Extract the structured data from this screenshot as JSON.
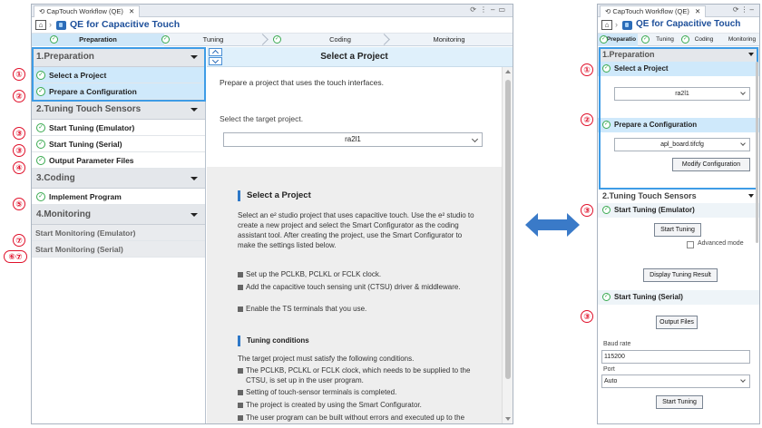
{
  "window_tab": "CapTouch Workflow (QE)",
  "app_title": "QE for Capacitive Touch",
  "steps": [
    "Preparation",
    "Tuning",
    "Coding",
    "Monitoring"
  ],
  "steps_short": [
    "Preparatio",
    "Tuning",
    "Coding",
    "Monitoring"
  ],
  "sidebar": {
    "sections": [
      {
        "title": "1.Preparation",
        "items": [
          "Select a Project",
          "Prepare a Configuration"
        ]
      },
      {
        "title": "2.Tuning Touch Sensors",
        "items": [
          "Start Tuning (Emulator)",
          "Start Tuning (Serial)",
          "Output Parameter Files"
        ]
      },
      {
        "title": "3.Coding",
        "items": [
          "Implement Program"
        ]
      },
      {
        "title": "4.Monitoring",
        "items": [
          "Start Monitoring (Emulator)",
          "Start Monitoring (Serial)"
        ]
      }
    ]
  },
  "markers": [
    "①",
    "②",
    "③",
    "③",
    "④",
    "⑤",
    "⑦",
    "⑥⑦"
  ],
  "main": {
    "header": "Select a Project",
    "description": "Prepare a project that uses the touch interfaces.",
    "target_label": "Select the target project.",
    "project_value": "ra2l1",
    "help_title": "Select a Project",
    "help_para": "Select an e² studio project that uses capacitive touch. Use the e² studio to create a new project and select the Smart Configurator as the coding assistant tool. After creating the project, use the Smart Configurator to make the settings listed below.",
    "help_bullets": [
      "Set up the PCLKB, PCLKL or FCLK clock.",
      "Add the capacitive touch sensing unit (CTSU) driver & middleware.",
      "Enable the TS terminals that you use."
    ],
    "tuning_title": "Tuning conditions",
    "tuning_para": "The target project must satisfy the following conditions.",
    "tuning_bullets": [
      "The PCLKB, PCLKL or FCLK clock, which needs to be supplied to the CTSU, is set up in the user program.",
      "Setting of touch-sensor terminals is completed.",
      "The project is created by using the Smart Configurator.",
      "The user program can be built without errors and executed up to the beginning of the main function."
    ]
  },
  "right_panel": {
    "sect1": "1.Preparation",
    "select_project": "Select a Project",
    "project_value": "ra2l1",
    "prepare_config": "Prepare a Configuration",
    "config_value": "apl_board.tifcfg",
    "modify_btn": "Modify Configuration",
    "sect2": "2.Tuning Touch Sensors",
    "start_emulator": "Start Tuning (Emulator)",
    "start_tuning_btn": "Start Tuning",
    "advanced_mode": "Advanced mode",
    "display_result_btn": "Display Tuning Result",
    "start_serial": "Start Tuning (Serial)",
    "output_files_btn": "Output Files",
    "baud_label": "Baud rate",
    "baud_value": "115200",
    "port_label": "Port",
    "port_value": "Auto",
    "start_tuning_btn2": "Start Tuning",
    "markers": [
      "①",
      "②",
      "③",
      "③"
    ]
  },
  "colors": {
    "accent": "#3e9ce6",
    "marker": "#e0102a",
    "check": "#3aaa50",
    "arrow": "#3a7ac8"
  }
}
